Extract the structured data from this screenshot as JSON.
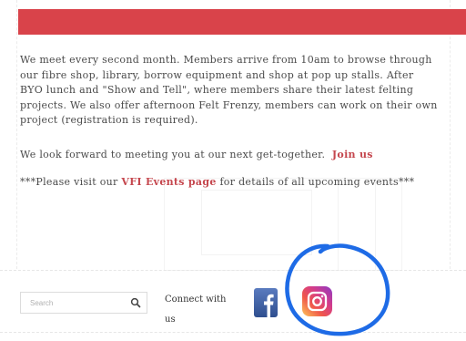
{
  "content": {
    "paragraph1": "We meet every second month. Members arrive from 10am to browse through our fibre shop, library, borrow equipment and shop at pop up stalls. After BYO lunch and \"Show and Tell\", where members share their latest felting projects. We also offer afternoon Felt Frenzy, members can work on their own project (registration is required).",
    "paragraph2_text": "We look forward to meeting you at our next get-together.",
    "join_link": "Join us",
    "paragraph3_prefix": "***Please visit our",
    "events_link": "VFI Events page",
    "paragraph3_suffix": "for details of all upcoming events***"
  },
  "footer": {
    "search": {
      "placeholder": "Search",
      "icon": "magnifier-icon"
    },
    "connect_label": "Connect with us",
    "social": [
      {
        "name": "Facebook",
        "icon": "facebook-icon",
        "color": "#3b5998"
      },
      {
        "name": "Instagram",
        "icon": "instagram-icon"
      }
    ]
  },
  "colors": {
    "banner": "#d9434a",
    "link": "#c5474e",
    "annotation": "#1e6be6"
  }
}
